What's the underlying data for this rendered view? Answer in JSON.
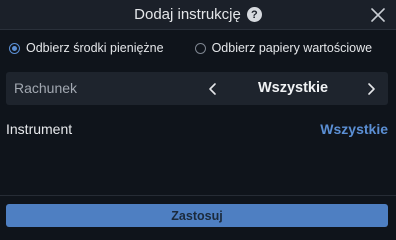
{
  "header": {
    "title": "Dodaj instrukcję",
    "help_glyph": "?",
    "help_icon": "question-circle-icon",
    "close_icon": "close-icon"
  },
  "radio": {
    "options": [
      {
        "label": "Odbierz środki pieniężne",
        "selected": true
      },
      {
        "label": "Odbierz papiery wartościowe",
        "selected": false
      }
    ]
  },
  "account": {
    "label": "Rachunek",
    "value": "Wszystkie",
    "prev_icon": "chevron-left-icon",
    "next_icon": "chevron-right-icon"
  },
  "instrument": {
    "label": "Instrument",
    "value": "Wszystkie"
  },
  "footer": {
    "apply_label": "Zastosuj"
  },
  "colors": {
    "background": "#0f141b",
    "header": "#1b2029",
    "accent": "#5b8fd4",
    "button": "#4e7fc2"
  }
}
